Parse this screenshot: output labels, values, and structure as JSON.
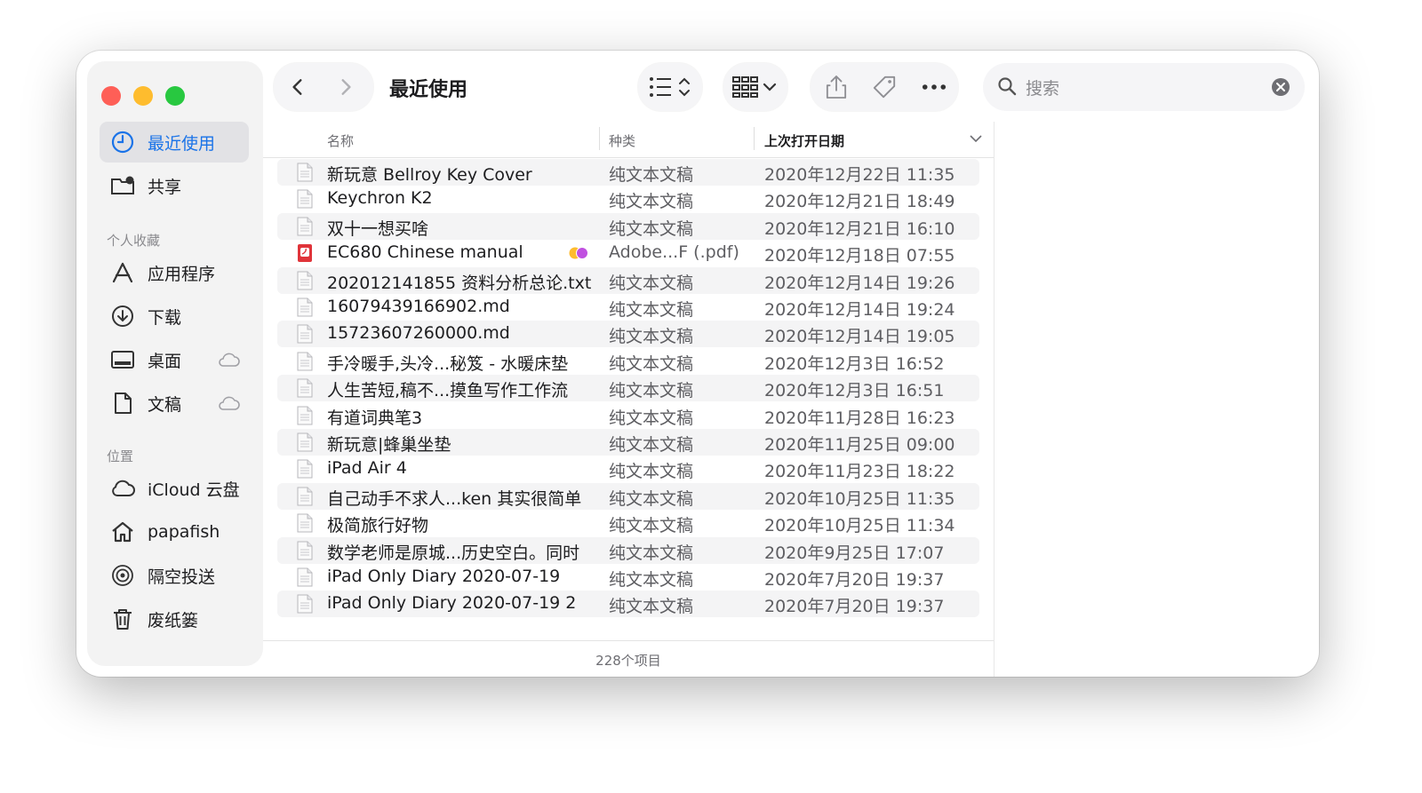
{
  "window": {
    "title": "最近使用"
  },
  "sidebar": {
    "top_items": [
      {
        "label": "最近使用",
        "icon": "clock-icon",
        "active": true
      },
      {
        "label": "共享",
        "icon": "shared-folder-icon"
      }
    ],
    "favorites_title": "个人收藏",
    "favorites": [
      {
        "label": "应用程序",
        "icon": "applications-icon"
      },
      {
        "label": "下载",
        "icon": "download-icon"
      },
      {
        "label": "桌面",
        "icon": "desktop-icon",
        "cloud": true
      },
      {
        "label": "文稿",
        "icon": "document-icon",
        "cloud": true
      }
    ],
    "locations_title": "位置",
    "locations": [
      {
        "label": "iCloud 云盘",
        "icon": "icloud-icon"
      },
      {
        "label": "papafish",
        "icon": "home-icon"
      },
      {
        "label": "隔空投送",
        "icon": "airdrop-icon"
      },
      {
        "label": "废纸篓",
        "icon": "trash-icon"
      }
    ]
  },
  "toolbar": {
    "back": "back-chevron-icon",
    "forward": "forward-chevron-icon",
    "view_list": "list-view-icon",
    "group": "grid-group-icon",
    "share": "share-icon",
    "tag": "tag-icon",
    "more": "more-icon"
  },
  "search": {
    "placeholder": "搜索"
  },
  "columns": {
    "name": "名称",
    "kind": "种类",
    "date": "上次打开日期"
  },
  "files": [
    {
      "name": "新玩意 Bellroy Key Cover",
      "kind": "纯文本文稿",
      "date": "2020年12月22日 11:35"
    },
    {
      "name": "Keychron K2",
      "kind": "纯文本文稿",
      "date": "2020年12月21日 18:49"
    },
    {
      "name": "双十一想买啥",
      "kind": "纯文本文稿",
      "date": "2020年12月21日 16:10"
    },
    {
      "name": "EC680 Chinese manual",
      "kind": "Adobe...F (.pdf)",
      "date": "2020年12月18日 07:55",
      "pdf": true,
      "tags": true
    },
    {
      "name": "202012141855 资料分析总论.txt",
      "kind": "纯文本文稿",
      "date": "2020年12月14日 19:26"
    },
    {
      "name": "16079439166902.md",
      "kind": "纯文本文稿",
      "date": "2020年12月14日 19:24"
    },
    {
      "name": "15723607260000.md",
      "kind": "纯文本文稿",
      "date": "2020年12月14日 19:05"
    },
    {
      "name": "手冷暖手,头冷...秘笈 - 水暖床垫",
      "kind": "纯文本文稿",
      "date": "2020年12月3日 16:52"
    },
    {
      "name": "人生苦短,稿不...摸鱼写作工作流",
      "kind": "纯文本文稿",
      "date": "2020年12月3日 16:51"
    },
    {
      "name": "有道词典笔3",
      "kind": "纯文本文稿",
      "date": "2020年11月28日 16:23"
    },
    {
      "name": "新玩意|蜂巢坐垫",
      "kind": "纯文本文稿",
      "date": "2020年11月25日 09:00"
    },
    {
      "name": "iPad Air 4",
      "kind": "纯文本文稿",
      "date": "2020年11月23日 18:22"
    },
    {
      "name": "自己动手不求人...ken 其实很简单",
      "kind": "纯文本文稿",
      "date": "2020年10月25日 11:35"
    },
    {
      "name": "极简旅行好物",
      "kind": "纯文本文稿",
      "date": "2020年10月25日 11:34"
    },
    {
      "name": "数学老师是原城...历史空白。同时",
      "kind": "纯文本文稿",
      "date": "2020年9月25日 17:07"
    },
    {
      "name": "iPad Only Diary 2020-07-19",
      "kind": "纯文本文稿",
      "date": "2020年7月20日 19:37"
    },
    {
      "name": "iPad Only Diary 2020-07-19 2",
      "kind": "纯文本文稿",
      "date": "2020年7月20日 19:37"
    }
  ],
  "status": {
    "count": "228个项目"
  },
  "colors": {
    "accent": "#1a73e8",
    "red": "#fe5f57",
    "yellow": "#febc2e",
    "green": "#28c840",
    "pdf": "#e0343a"
  }
}
